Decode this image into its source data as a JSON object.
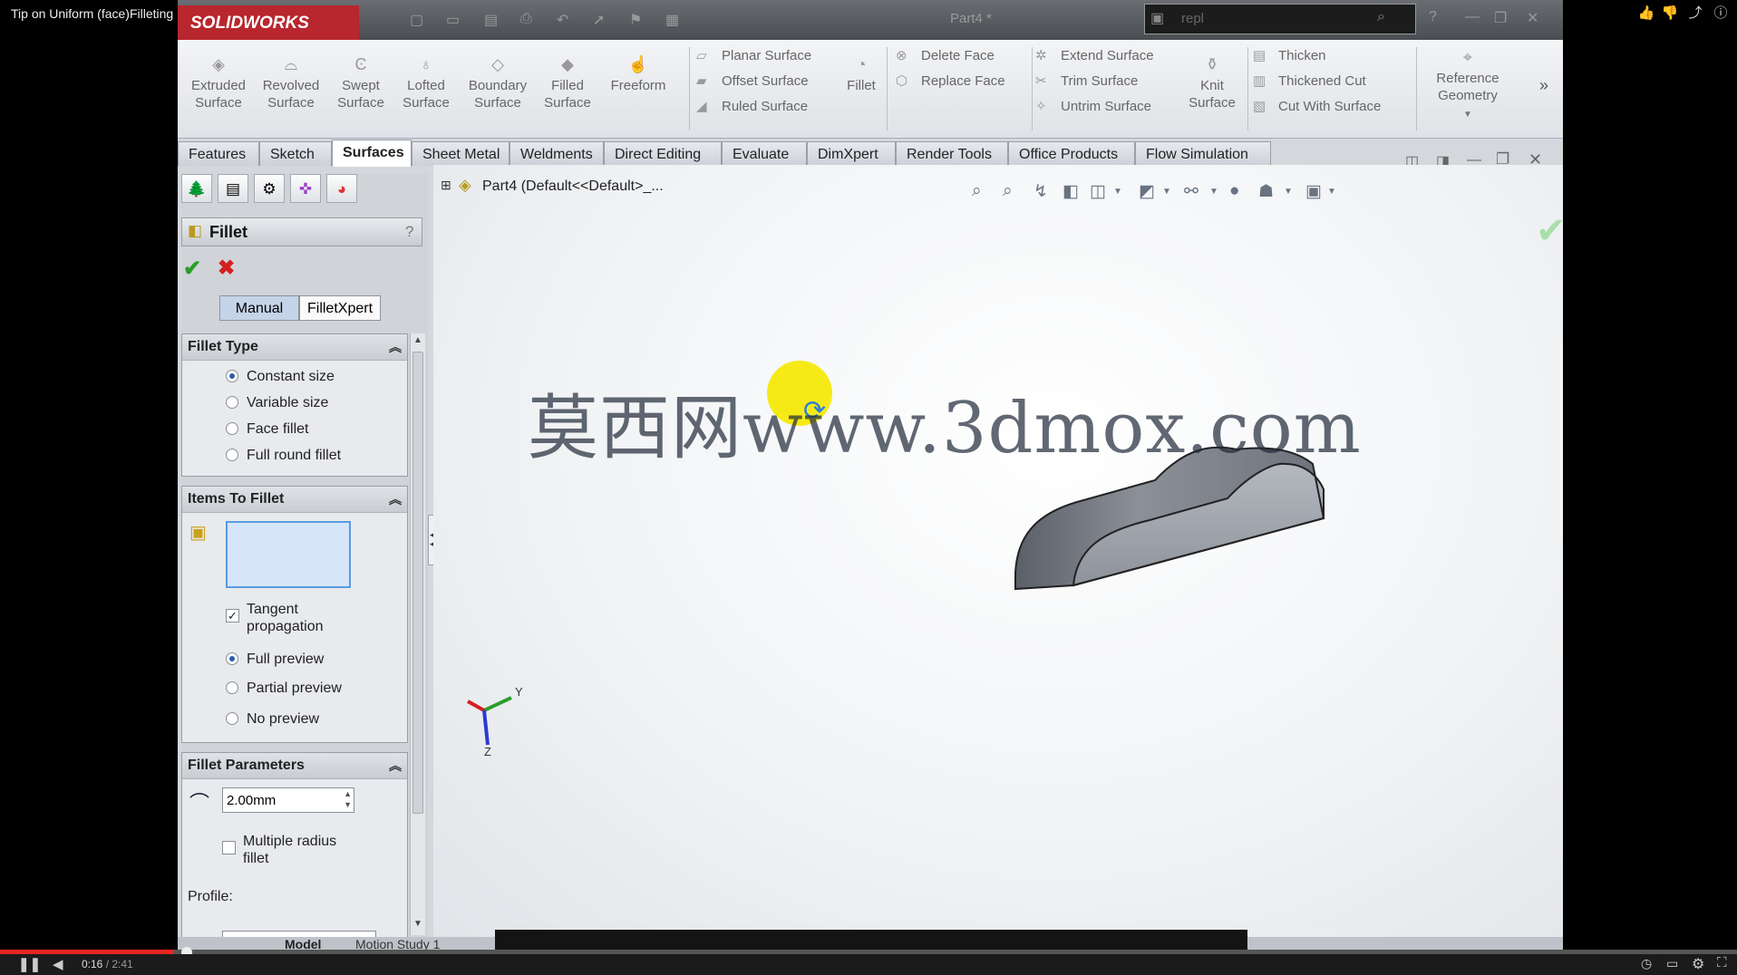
{
  "video": {
    "title": "Tip on Uniform (face)Filleting Irregular edge in Solidworks",
    "time_current": "0:16",
    "time_sep": " / ",
    "time_total": "2:41",
    "progress": 0.1
  },
  "app": {
    "logo": "SOLIDWORKS",
    "doc_title": "Part4 *",
    "search_text": "repl"
  },
  "ribbon": {
    "buttons": [
      {
        "line1": "Extruded",
        "line2": "Surface"
      },
      {
        "line1": "Revolved",
        "line2": "Surface"
      },
      {
        "line1": "Swept",
        "line2": "Surface"
      },
      {
        "line1": "Lofted",
        "line2": "Surface"
      },
      {
        "line1": "Boundary",
        "line2": "Surface"
      },
      {
        "line1": "Filled",
        "line2": "Surface"
      },
      {
        "line1": "Freeform",
        "line2": ""
      }
    ],
    "col1": [
      "Planar Surface",
      "Offset Surface",
      "Ruled Surface"
    ],
    "fillet": "Fillet",
    "col2": [
      "Delete Face",
      "Replace Face"
    ],
    "col3": [
      "Extend Surface",
      "Trim Surface",
      "Untrim Surface"
    ],
    "knit": {
      "line1": "Knit",
      "line2": "Surface"
    },
    "col4": [
      "Thicken",
      "Thickened Cut",
      "Cut With Surface"
    ],
    "ref": {
      "line1": "Reference",
      "line2": "Geometry"
    }
  },
  "tabs": [
    "Features",
    "Sketch",
    "Surfaces",
    "Sheet Metal",
    "Weldments",
    "Direct Editing",
    "Evaluate",
    "DimXpert",
    "Render Tools",
    "Office Products",
    "Flow Simulation"
  ],
  "panel": {
    "title": "Fillet",
    "help": "?",
    "mode_manual": "Manual",
    "mode_xpert": "FilletXpert",
    "fillet_type": {
      "title": "Fillet Type",
      "options": [
        "Constant size",
        "Variable size",
        "Face fillet",
        "Full round fillet"
      ]
    },
    "items": {
      "title": "Items To Fillet",
      "tangent_1": "Tangent",
      "tangent_2": "propagation",
      "preview": [
        "Full preview",
        "Partial preview",
        "No preview"
      ]
    },
    "params": {
      "title": "Fillet Parameters",
      "radius": "2.00mm",
      "multi_1": "Multiple radius",
      "multi_2": "fillet",
      "profile": "Profile:"
    }
  },
  "viewport": {
    "tree": "Part4  (Default<<Default>_...",
    "watermark": "莫西网www.3dmox.com",
    "axis_y": "Y",
    "axis_z": "Z"
  },
  "bottom_tabs": [
    "Model",
    "Motion Study 1"
  ]
}
